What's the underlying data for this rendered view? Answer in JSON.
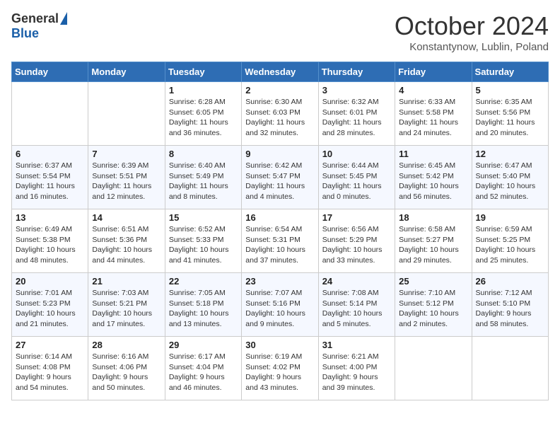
{
  "header": {
    "logo": {
      "general": "General",
      "blue": "Blue"
    },
    "title": "October 2024",
    "subtitle": "Konstantynow, Lublin, Poland"
  },
  "weekdays": [
    "Sunday",
    "Monday",
    "Tuesday",
    "Wednesday",
    "Thursday",
    "Friday",
    "Saturday"
  ],
  "weeks": [
    [
      {
        "day": "",
        "sunrise": "",
        "sunset": "",
        "daylight": ""
      },
      {
        "day": "",
        "sunrise": "",
        "sunset": "",
        "daylight": ""
      },
      {
        "day": "1",
        "sunrise": "Sunrise: 6:28 AM",
        "sunset": "Sunset: 6:05 PM",
        "daylight": "Daylight: 11 hours and 36 minutes."
      },
      {
        "day": "2",
        "sunrise": "Sunrise: 6:30 AM",
        "sunset": "Sunset: 6:03 PM",
        "daylight": "Daylight: 11 hours and 32 minutes."
      },
      {
        "day": "3",
        "sunrise": "Sunrise: 6:32 AM",
        "sunset": "Sunset: 6:01 PM",
        "daylight": "Daylight: 11 hours and 28 minutes."
      },
      {
        "day": "4",
        "sunrise": "Sunrise: 6:33 AM",
        "sunset": "Sunset: 5:58 PM",
        "daylight": "Daylight: 11 hours and 24 minutes."
      },
      {
        "day": "5",
        "sunrise": "Sunrise: 6:35 AM",
        "sunset": "Sunset: 5:56 PM",
        "daylight": "Daylight: 11 hours and 20 minutes."
      }
    ],
    [
      {
        "day": "6",
        "sunrise": "Sunrise: 6:37 AM",
        "sunset": "Sunset: 5:54 PM",
        "daylight": "Daylight: 11 hours and 16 minutes."
      },
      {
        "day": "7",
        "sunrise": "Sunrise: 6:39 AM",
        "sunset": "Sunset: 5:51 PM",
        "daylight": "Daylight: 11 hours and 12 minutes."
      },
      {
        "day": "8",
        "sunrise": "Sunrise: 6:40 AM",
        "sunset": "Sunset: 5:49 PM",
        "daylight": "Daylight: 11 hours and 8 minutes."
      },
      {
        "day": "9",
        "sunrise": "Sunrise: 6:42 AM",
        "sunset": "Sunset: 5:47 PM",
        "daylight": "Daylight: 11 hours and 4 minutes."
      },
      {
        "day": "10",
        "sunrise": "Sunrise: 6:44 AM",
        "sunset": "Sunset: 5:45 PM",
        "daylight": "Daylight: 11 hours and 0 minutes."
      },
      {
        "day": "11",
        "sunrise": "Sunrise: 6:45 AM",
        "sunset": "Sunset: 5:42 PM",
        "daylight": "Daylight: 10 hours and 56 minutes."
      },
      {
        "day": "12",
        "sunrise": "Sunrise: 6:47 AM",
        "sunset": "Sunset: 5:40 PM",
        "daylight": "Daylight: 10 hours and 52 minutes."
      }
    ],
    [
      {
        "day": "13",
        "sunrise": "Sunrise: 6:49 AM",
        "sunset": "Sunset: 5:38 PM",
        "daylight": "Daylight: 10 hours and 48 minutes."
      },
      {
        "day": "14",
        "sunrise": "Sunrise: 6:51 AM",
        "sunset": "Sunset: 5:36 PM",
        "daylight": "Daylight: 10 hours and 44 minutes."
      },
      {
        "day": "15",
        "sunrise": "Sunrise: 6:52 AM",
        "sunset": "Sunset: 5:33 PM",
        "daylight": "Daylight: 10 hours and 41 minutes."
      },
      {
        "day": "16",
        "sunrise": "Sunrise: 6:54 AM",
        "sunset": "Sunset: 5:31 PM",
        "daylight": "Daylight: 10 hours and 37 minutes."
      },
      {
        "day": "17",
        "sunrise": "Sunrise: 6:56 AM",
        "sunset": "Sunset: 5:29 PM",
        "daylight": "Daylight: 10 hours and 33 minutes."
      },
      {
        "day": "18",
        "sunrise": "Sunrise: 6:58 AM",
        "sunset": "Sunset: 5:27 PM",
        "daylight": "Daylight: 10 hours and 29 minutes."
      },
      {
        "day": "19",
        "sunrise": "Sunrise: 6:59 AM",
        "sunset": "Sunset: 5:25 PM",
        "daylight": "Daylight: 10 hours and 25 minutes."
      }
    ],
    [
      {
        "day": "20",
        "sunrise": "Sunrise: 7:01 AM",
        "sunset": "Sunset: 5:23 PM",
        "daylight": "Daylight: 10 hours and 21 minutes."
      },
      {
        "day": "21",
        "sunrise": "Sunrise: 7:03 AM",
        "sunset": "Sunset: 5:21 PM",
        "daylight": "Daylight: 10 hours and 17 minutes."
      },
      {
        "day": "22",
        "sunrise": "Sunrise: 7:05 AM",
        "sunset": "Sunset: 5:18 PM",
        "daylight": "Daylight: 10 hours and 13 minutes."
      },
      {
        "day": "23",
        "sunrise": "Sunrise: 7:07 AM",
        "sunset": "Sunset: 5:16 PM",
        "daylight": "Daylight: 10 hours and 9 minutes."
      },
      {
        "day": "24",
        "sunrise": "Sunrise: 7:08 AM",
        "sunset": "Sunset: 5:14 PM",
        "daylight": "Daylight: 10 hours and 5 minutes."
      },
      {
        "day": "25",
        "sunrise": "Sunrise: 7:10 AM",
        "sunset": "Sunset: 5:12 PM",
        "daylight": "Daylight: 10 hours and 2 minutes."
      },
      {
        "day": "26",
        "sunrise": "Sunrise: 7:12 AM",
        "sunset": "Sunset: 5:10 PM",
        "daylight": "Daylight: 9 hours and 58 minutes."
      }
    ],
    [
      {
        "day": "27",
        "sunrise": "Sunrise: 6:14 AM",
        "sunset": "Sunset: 4:08 PM",
        "daylight": "Daylight: 9 hours and 54 minutes."
      },
      {
        "day": "28",
        "sunrise": "Sunrise: 6:16 AM",
        "sunset": "Sunset: 4:06 PM",
        "daylight": "Daylight: 9 hours and 50 minutes."
      },
      {
        "day": "29",
        "sunrise": "Sunrise: 6:17 AM",
        "sunset": "Sunset: 4:04 PM",
        "daylight": "Daylight: 9 hours and 46 minutes."
      },
      {
        "day": "30",
        "sunrise": "Sunrise: 6:19 AM",
        "sunset": "Sunset: 4:02 PM",
        "daylight": "Daylight: 9 hours and 43 minutes."
      },
      {
        "day": "31",
        "sunrise": "Sunrise: 6:21 AM",
        "sunset": "Sunset: 4:00 PM",
        "daylight": "Daylight: 9 hours and 39 minutes."
      },
      {
        "day": "",
        "sunrise": "",
        "sunset": "",
        "daylight": ""
      },
      {
        "day": "",
        "sunrise": "",
        "sunset": "",
        "daylight": ""
      }
    ]
  ]
}
